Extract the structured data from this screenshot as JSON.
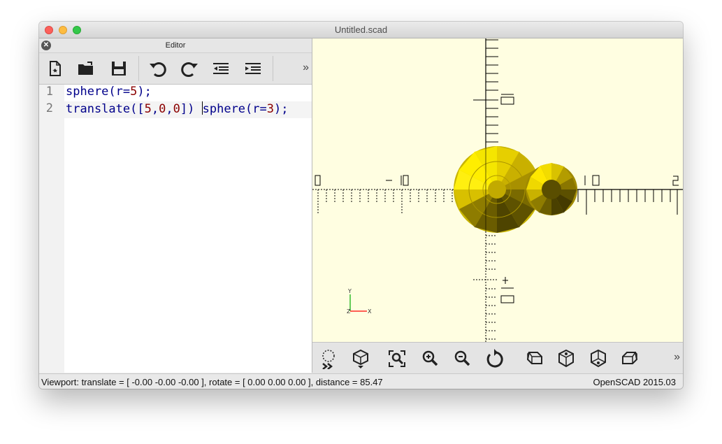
{
  "window": {
    "title": "Untitled.scad"
  },
  "editor": {
    "panel_title": "Editor",
    "close_glyph": "✕",
    "toolbar": {
      "icons": [
        "new-file-icon",
        "open-folder-icon",
        "save-icon",
        "undo-icon",
        "redo-icon",
        "unindent-icon",
        "indent-icon"
      ],
      "more": "»"
    },
    "lines": [
      {
        "number": "1",
        "text": "sphere(r=5);"
      },
      {
        "number": "2",
        "text": "translate([5,0,0]) sphere(r=3);"
      }
    ]
  },
  "viewport": {
    "axis_labels": [
      "Y",
      "Z",
      "X"
    ],
    "background": "#fffee1",
    "object_color": "#f5e000",
    "axis_colors": {
      "x": "#ff0000",
      "y": "#00aa00"
    }
  },
  "view_toolbar": {
    "icons": [
      "preview-icon",
      "render-icon",
      "view-all-icon",
      "zoom-in-icon",
      "zoom-out-icon",
      "reset-view-icon",
      "view-right-icon",
      "view-top-icon",
      "view-bottom-icon",
      "view-left-icon"
    ],
    "more": "»"
  },
  "status": {
    "viewport_info": "Viewport: translate = [ -0.00 -0.00 -0.00 ], rotate = [ 0.00 0.00 0.00 ], distance = 85.47",
    "version": "OpenSCAD 2015.03"
  }
}
